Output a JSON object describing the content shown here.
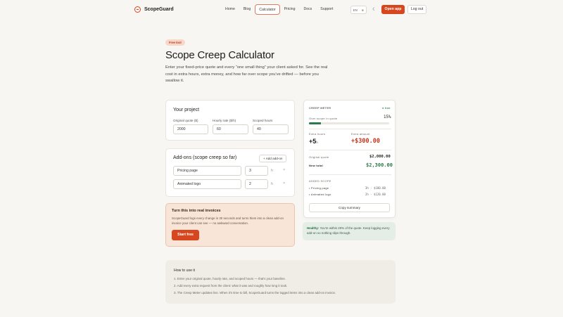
{
  "nav": {
    "brand": "ScopeGuard",
    "links": [
      "Home",
      "Blog",
      "Calculator",
      "Pricing",
      "Docs",
      "Support"
    ],
    "lang": "EN",
    "lang_icon": "globe-icon",
    "theme_icon": "moon-icon",
    "open_app": "Open app",
    "logout": "Log out"
  },
  "hero": {
    "badge": "Free tool",
    "title": "Scope Creep Calculator",
    "intro": "Enter your fixed-price quote and every “one small thing” your client asked for. See the real cost in extra hours, extra money, and how far over scope you've drifted — before you swallow it."
  },
  "project": {
    "title": "Your project",
    "quote_label": "Original quote ($)",
    "quote_value": "2000",
    "rate_label": "Hourly rate ($/h)",
    "rate_value": "60",
    "hours_label": "Scoped hours",
    "hours_value": "40"
  },
  "addons": {
    "title": "Add-ons (scope creep so far)",
    "add_button": "+ Add add-on",
    "items": [
      {
        "name": "Pricing page",
        "hours": "3"
      },
      {
        "name": "Animated logo",
        "hours": "2"
      }
    ],
    "remove_symbol": "×"
  },
  "cta": {
    "title": "Turn this into real invoices",
    "text": "ScopeGuard logs every change in 30 seconds and turns them into a clean add-on invoice your client can see — no awkward conversation.",
    "button": "Start free"
  },
  "meter": {
    "heading": "CREEP METER",
    "live": "● live",
    "over_label": "Over scope in quote",
    "over_value": "15%",
    "over_fraction": 0.15,
    "extra_hours_label": "Extra hours",
    "extra_hours_value": "+5",
    "extra_hours_unit": "h",
    "extra_amount_label": "Extra amount",
    "extra_amount_value": "+$300.00",
    "original_label": "Original quote",
    "original_value": "$2,000.00",
    "new_total_label": "New total",
    "new_total_value": "$2,300.00",
    "added_heading": "ADDED SCOPE",
    "added": [
      {
        "name": "Pricing page",
        "detail": "3h · $180.00"
      },
      {
        "name": "Animated logo",
        "detail": "2h · $120.00"
      }
    ],
    "copy_button": "Copy summary"
  },
  "healthy": {
    "label": "Healthy:",
    "text": "You're within 20% of the quote. Keep logging every add-on so nothing slips through."
  },
  "howto": {
    "title": "How to use it",
    "steps": [
      "1. Enter your original quote, hourly rate, and scoped hours — that's your baseline.",
      "2. Add every extra request from the client: what it was and roughly how long it took.",
      "3. The Creep Meter updates live. When it's time to bill, ScopeGuard turns the logged items into a clean add-on invoice."
    ]
  },
  "colors": {
    "accent": "#d6461f",
    "success": "#2b7a4b",
    "danger": "#c8341c",
    "background": "#f7f6f2"
  }
}
